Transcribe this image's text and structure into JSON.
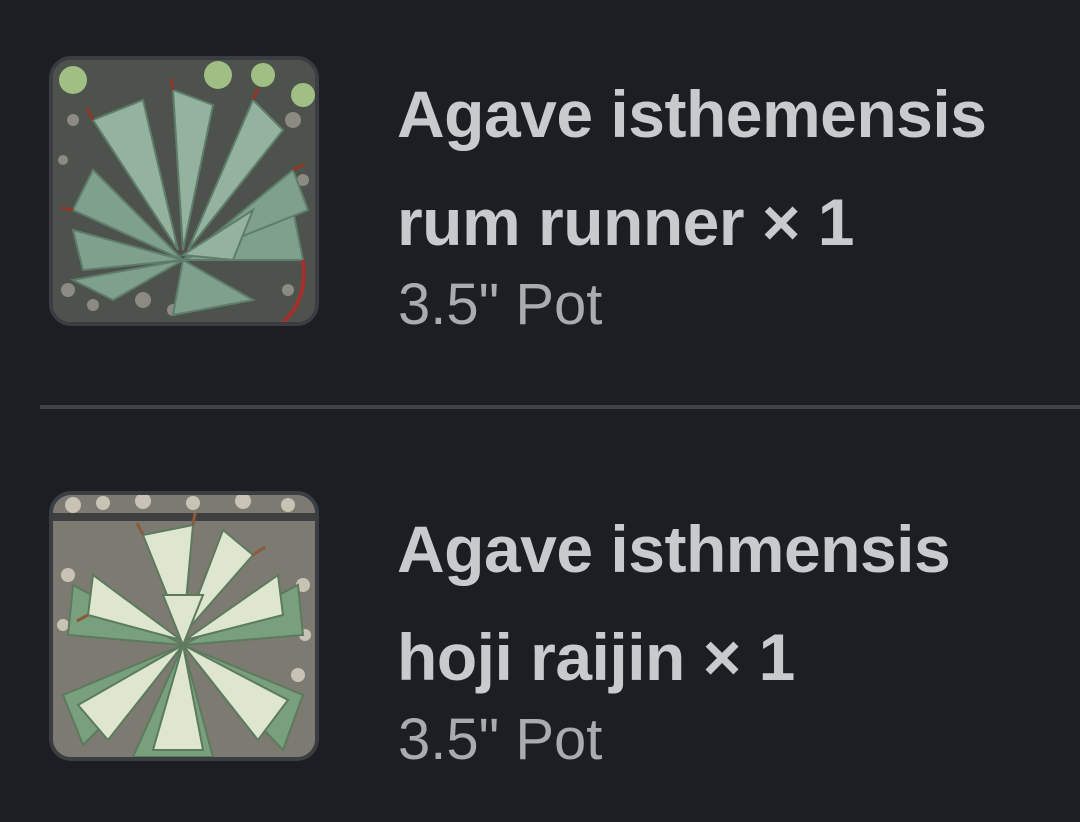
{
  "cart_items": [
    {
      "title_line1": "Agave isthemensis",
      "title_line2": "rum runner × 1",
      "subtitle": "3.5\" Pot",
      "thumbnail_icon": "plant-photo-icon",
      "plant_colors": {
        "leaf": "#7fa08c",
        "leaf_light": "#a9c2b0",
        "spine": "#8b3a2a",
        "soil": "#5b5e58"
      }
    },
    {
      "title_line1": "Agave isthmensis",
      "title_line2": "hoji raijin × 1",
      "subtitle": "3.5\" Pot",
      "thumbnail_icon": "plant-photo-icon",
      "plant_colors": {
        "leaf": "#79a07c",
        "leaf_light": "#dfe6cf",
        "spine": "#8b5a3a",
        "soil": "#8d8a80"
      }
    }
  ]
}
